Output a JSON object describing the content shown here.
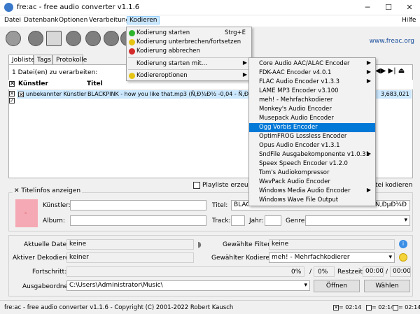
{
  "window": {
    "title": "fre:ac - free audio converter v1.1.6",
    "minimize": "─",
    "maximize": "☐",
    "close": "✕"
  },
  "menubar": [
    "Datei",
    "Datenbank",
    "Optionen",
    "Verarbeitung",
    "Kodieren",
    "Hilfe"
  ],
  "toolbar": {
    "link": "www.freac.org"
  },
  "tabs": [
    "Jobliste",
    "Tags",
    "Protokolle"
  ],
  "joblist": {
    "count_label": "1 Datei(en) zu verarbeiten:",
    "col_artist": "Künstler",
    "col_title": "Titel",
    "rows": [
      {
        "artist": "unbekannter Künstler",
        "title": "BLACKPINK - how you like that.mp3 (Ñ,Ð¾Ð½ -0,04 - Ñ,Ðµ",
        "size": "3,683,021"
      }
    ]
  },
  "options": {
    "playlist": "Playliste erzeuger",
    "cue": "tei kodieren"
  },
  "titleinfo": {
    "toggle": "Titelinfos anzeigen",
    "artist_label": "Künstler:",
    "album_label": "Album:",
    "title_label": "Titel:",
    "title_value": "BLAC",
    "title_value_right": "- Ñ,ÐµÐ¼Ð",
    "track_label": "Track:",
    "year_label": "Jahr:",
    "genre_label": "Genre:"
  },
  "bottom": {
    "current_file_label": "Aktuelle Datei:",
    "current_file": "keine",
    "active_decoder_label": "Aktiver Dekodierer:",
    "active_decoder": "keiner",
    "filter_label": "Gewählte Filter:",
    "filter": "keine",
    "encoder_label": "Gewählter Kodierer:",
    "encoder": "meh! - Mehrfachkodierer",
    "progress_label": "Fortschritt:",
    "progress_pct": "0%",
    "progress_sep": "/",
    "progress_total": "0%",
    "remaining_label": "Restzeit:",
    "remaining_a": "00:00",
    "remaining_sep": "/",
    "remaining_b": "00:00",
    "output_label": "Ausgabeordner:",
    "output_path": "C:\\Users\\Administrator\\Music\\",
    "open_btn": "Öffnen",
    "choose_btn": "Wählen"
  },
  "statusbar": {
    "text": "fre:ac - free audio converter v1.1.6 - Copyright (C) 2001-2022 Robert Kausch",
    "t1": "= 02:14",
    "t2": "= 02:14",
    "t3": "= 02:14"
  },
  "menu_kodieren": {
    "items": [
      {
        "label": "Kodierung starten",
        "shortcut": "Strg+E",
        "color": "#2db52d"
      },
      {
        "label": "Kodierung unterbrechen/fortsetzen",
        "shortcut": "",
        "color": "#e5c413"
      },
      {
        "label": "Kodierung abbrechen",
        "shortcut": "",
        "color": "#d42a2a"
      },
      {
        "label": "Kodierung starten mit...",
        "shortcut": "",
        "color": ""
      },
      {
        "label": "Kodiereroptionen",
        "shortcut": "",
        "color": "#e5c413"
      }
    ]
  },
  "submenu_encoders": [
    "Core Audio AAC/ALAC Encoder",
    "FDK-AAC Encoder v4.0.1",
    "FLAC Audio Encoder v1.3.3",
    "LAME MP3 Encoder v3.100",
    "meh! - Mehrfachkodierer",
    "Monkey's Audio Encoder",
    "Musepack Audio Encoder",
    "Ogg Vorbis Encoder",
    "OptimFROG Lossless Encoder",
    "Opus Audio Encoder v1.3.1",
    "SndFile Ausgabekomponente v1.0.31",
    "Speex Speech Encoder v1.2.0",
    "Tom's Audiokompressor",
    "WavPack Audio Encoder",
    "Windows Media Audio Encoder",
    "Windows Wave File Output"
  ],
  "colors": {
    "accent": "#0078d7",
    "highlight": "#cce8ff",
    "cover": "#f4a9b4"
  }
}
